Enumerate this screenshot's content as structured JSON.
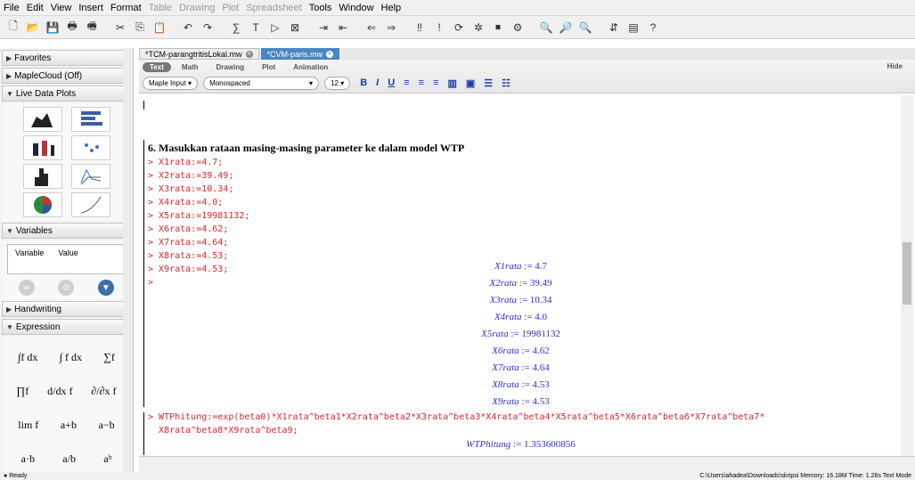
{
  "menu": [
    "File",
    "Edit",
    "View",
    "Insert",
    "Format",
    "Table",
    "Drawing",
    "Plot",
    "Spreadsheet",
    "Tools",
    "Window",
    "Help"
  ],
  "menu_disabled": [
    "Table",
    "Drawing",
    "Plot",
    "Spreadsheet"
  ],
  "palettes": {
    "favorites": "Favorites",
    "maplecloud": "MapleCloud (Off)",
    "liveplots": "Live Data Plots",
    "variables": "Variables",
    "var_col1": "Variable",
    "var_col2": "Value",
    "handwriting": "Handwriting",
    "expression": "Expression"
  },
  "tabs": [
    {
      "label": "*TCM-parangtritisLokal.mw",
      "active": false
    },
    {
      "label": "*CVM-paris.mw",
      "active": true
    }
  ],
  "ctx_tabs": [
    "Text",
    "Math",
    "Drawing",
    "Plot",
    "Animation"
  ],
  "ctx_hide": "Hide",
  "ctx_input": "Maple Input",
  "ctx_font": "Monospaced",
  "ctx_size": "12",
  "heading": "6. Masukkan rataan masing-masing parameter ke dalam model WTP",
  "inputs": [
    "X1rata:=4.7;",
    "X2rata:=39.49;",
    "X3rata:=10.34;",
    "X4rata:=4.0;",
    "X5rata:=19981132;",
    "X6rata:=4.62;",
    "X7rata:=4.64;",
    "X8rata:=4.53;",
    "X9rata:=4.53;",
    ""
  ],
  "outputs": [
    {
      "name": "X1rata",
      "val": ":= 4.7"
    },
    {
      "name": "X2rata",
      "val": ":= 39.49"
    },
    {
      "name": "X3rata",
      "val": ":= 10.34"
    },
    {
      "name": "X4rata",
      "val": ":= 4.0"
    },
    {
      "name": "X5rata",
      "val": ":= 19981132"
    },
    {
      "name": "X6rata",
      "val": ":= 4.62"
    },
    {
      "name": "X7rata",
      "val": ":= 4.64"
    },
    {
      "name": "X8rata",
      "val": ":= 4.53"
    },
    {
      "name": "X9rata",
      "val": ":= 4.53"
    }
  ],
  "wtp_input_1": "WTPhitung:=exp(beta0)*X1rata^beta1*X2rata^beta2*X3rata^beta3*X4rata^beta4*X5rata^beta5*X6rata^beta6*X7rata^beta7*",
  "wtp_input_2": "X8rata^beta8*X9rata^beta9;",
  "wtp_output_name": "WTPhitung",
  "wtp_output_val": ":= 1.353600856",
  "status_left": "Ready",
  "status_right": "C:\\Users\\ahadea\\Downloads\\skripsi  Memory: 16.18M  Time: 1.26s  Text Mode"
}
